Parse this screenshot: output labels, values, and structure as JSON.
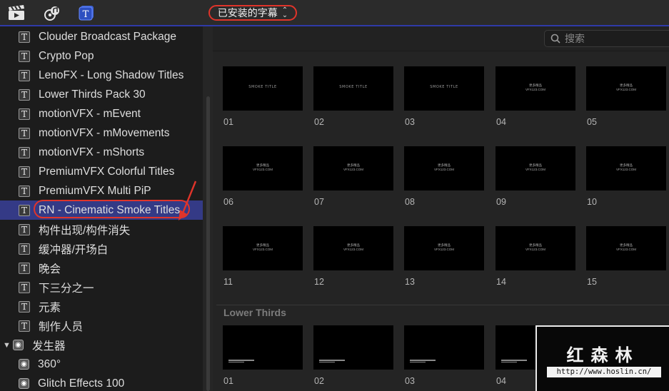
{
  "toolbar": {
    "library_dropdown_label": "已安装的字幕",
    "icons": [
      "clapper-board-icon",
      "music-camera-icon",
      "titles-icon"
    ]
  },
  "sidebar": {
    "items": [
      {
        "label": "Clouder Broadcast Package",
        "icon": "title-t-icon"
      },
      {
        "label": "Crypto Pop",
        "icon": "title-t-icon"
      },
      {
        "label": "LenoFX - Long Shadow Titles",
        "icon": "title-t-icon"
      },
      {
        "label": "Lower Thirds Pack 30",
        "icon": "title-t-icon"
      },
      {
        "label": "motionVFX - mEvent",
        "icon": "title-t-icon"
      },
      {
        "label": "motionVFX - mMovements",
        "icon": "title-t-icon"
      },
      {
        "label": "motionVFX - mShorts",
        "icon": "title-t-icon"
      },
      {
        "label": "PremiumVFX Colorful Titles",
        "icon": "title-t-icon"
      },
      {
        "label": "PremiumVFX Multi PiP",
        "icon": "title-t-icon"
      },
      {
        "label": "RN - Cinematic Smoke Titles",
        "icon": "title-t-icon",
        "selected": true
      },
      {
        "label": "构件出现/构件消失",
        "icon": "title-t-icon"
      },
      {
        "label": "缓冲器/开场白",
        "icon": "title-t-icon"
      },
      {
        "label": "晚会",
        "icon": "title-t-icon"
      },
      {
        "label": "下三分之一",
        "icon": "title-t-icon"
      },
      {
        "label": "元素",
        "icon": "title-t-icon"
      },
      {
        "label": "制作人员",
        "icon": "title-t-icon"
      },
      {
        "label": "发生器",
        "icon": "generator-icon",
        "group": true
      },
      {
        "label": "360°",
        "icon": "generator-icon"
      },
      {
        "label": "Glitch Effects 100",
        "icon": "generator-icon"
      }
    ]
  },
  "search": {
    "placeholder": "搜索"
  },
  "thumb_text": {
    "smoke_title": "SMOKE TITLE",
    "promo_line1": "更多精品",
    "promo_line2": "VFX123.COM"
  },
  "grid": {
    "captions": [
      "01",
      "02",
      "03",
      "04",
      "05",
      "06",
      "07",
      "08",
      "09",
      "10",
      "11",
      "12",
      "13",
      "14",
      "15"
    ]
  },
  "lower_thirds": {
    "section_title": "Lower Thirds",
    "captions": [
      "01",
      "02",
      "03",
      "04"
    ]
  },
  "watermark": {
    "title": "红森林",
    "url": "http://www.hoslin.cn/"
  },
  "colors": {
    "selection": "#343a86",
    "annotation_red": "#e0342a",
    "toolbar_accent": "#2f3aa8"
  }
}
